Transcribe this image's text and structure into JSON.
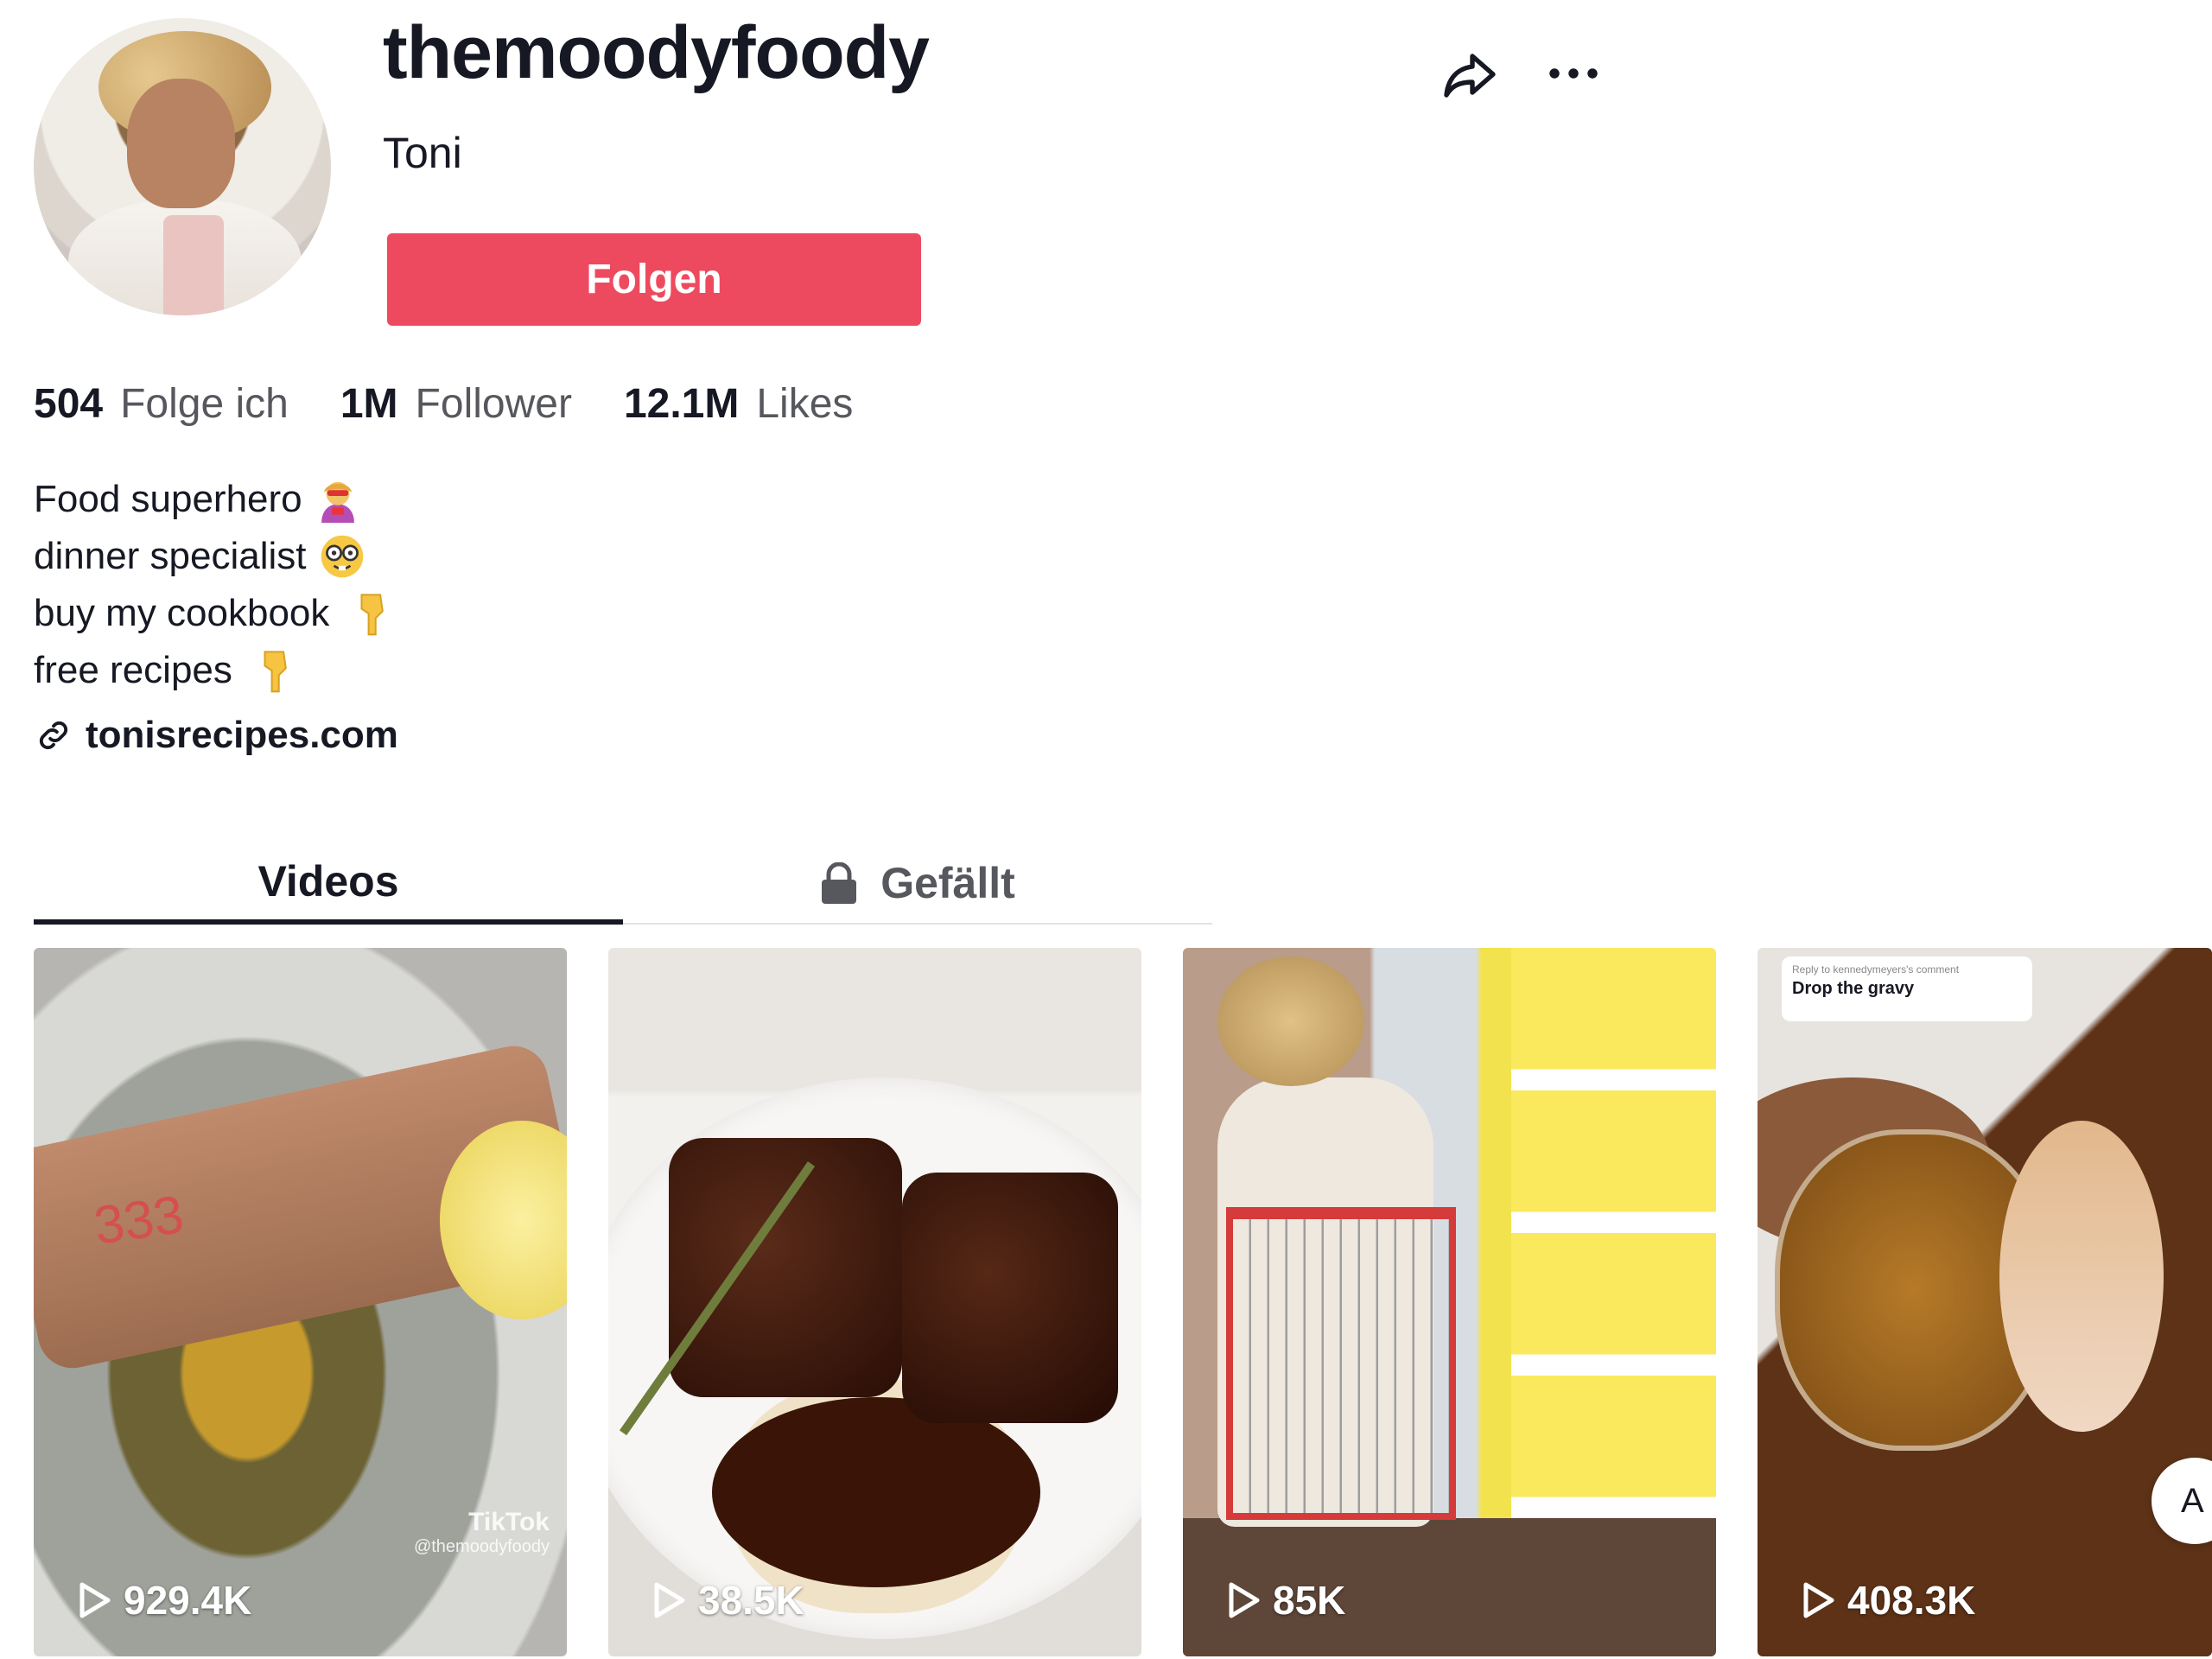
{
  "profile": {
    "username": "themoodyfoody",
    "nickname": "Toni",
    "follow_label": "Folgen"
  },
  "stats": [
    {
      "value": "504",
      "label": "Folge ich"
    },
    {
      "value": "1M",
      "label": "Follower"
    },
    {
      "value": "12.1M",
      "label": "Likes"
    }
  ],
  "bio": {
    "lines": [
      {
        "text": "Food superhero",
        "icon": "superhero-emoji-icon"
      },
      {
        "text": "dinner specialist",
        "icon": "nerd-face-emoji-icon"
      },
      {
        "text": "buy my cookbook",
        "icon": "pointing-down-emoji-icon"
      },
      {
        "text": "free recipes",
        "icon": "pointing-down-emoji-icon"
      }
    ],
    "link": "tonisrecipes.com"
  },
  "tabs": [
    {
      "label": "Videos",
      "active": true
    },
    {
      "label": "Gefällt",
      "locked": true
    }
  ],
  "videos": [
    {
      "views": "929.4K",
      "watermark": "TikTok",
      "watermark_handle": "@themoodyfoody"
    },
    {
      "views": "38.5K"
    },
    {
      "views": "85K"
    },
    {
      "views": "408.3K",
      "reply_text": "Reply to kennedymeyers's comment",
      "comment": "Drop the gravy"
    }
  ],
  "colors": {
    "accent": "#ee4a5f",
    "text": "#161823",
    "muted": "#57585e"
  }
}
